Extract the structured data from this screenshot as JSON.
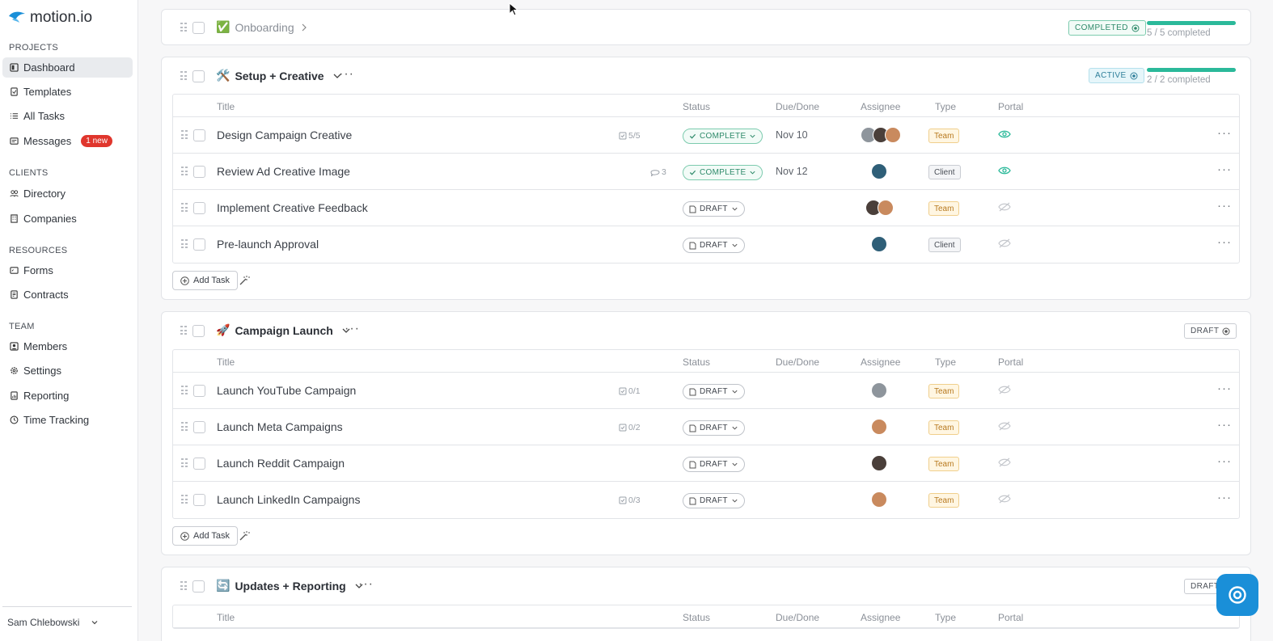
{
  "app": {
    "logo_text": "motion.io",
    "brand_color": "#1a8fd8"
  },
  "sidebar": {
    "sections": [
      {
        "label": "PROJECTS",
        "items": [
          {
            "label": "Dashboard",
            "icon": "dashboard-icon",
            "active": true
          },
          {
            "label": "Templates",
            "icon": "template-icon"
          },
          {
            "label": "All Tasks",
            "icon": "list-icon"
          },
          {
            "label": "Messages",
            "icon": "message-icon",
            "badge": "1 new"
          }
        ]
      },
      {
        "label": "CLIENTS",
        "items": [
          {
            "label": "Directory",
            "icon": "people-icon"
          },
          {
            "label": "Companies",
            "icon": "building-icon"
          }
        ]
      },
      {
        "label": "RESOURCES",
        "items": [
          {
            "label": "Forms",
            "icon": "form-icon"
          },
          {
            "label": "Contracts",
            "icon": "contract-icon"
          }
        ]
      },
      {
        "label": "TEAM",
        "items": [
          {
            "label": "Members",
            "icon": "members-icon"
          },
          {
            "label": "Settings",
            "icon": "gear-icon"
          },
          {
            "label": "Reporting",
            "icon": "report-icon"
          },
          {
            "label": "Time Tracking",
            "icon": "clock-icon"
          }
        ]
      }
    ],
    "user": {
      "name": "Sam Chlebowski"
    }
  },
  "columns": {
    "title": "Title",
    "status": "Status",
    "due": "Due/Done",
    "assignee": "Assignee",
    "type": "Type",
    "portal": "Portal"
  },
  "add_task_label": "Add Task",
  "projects": [
    {
      "emoji": "✅",
      "name": "Onboarding",
      "status": "COMPLETED",
      "progress_text": "5 / 5 completed",
      "progress": 1.0
    },
    {
      "emoji": "🛠️",
      "name": "Setup + Creative",
      "status": "ACTIVE",
      "progress_text": "2 / 2 completed",
      "progress": 1.0,
      "tasks": [
        {
          "title": "Design Campaign Creative",
          "meta": "5/5",
          "status": "COMPLETE",
          "due": "Nov 10",
          "type": "Team",
          "portal_visible": true
        },
        {
          "title": "Review Ad Creative Image",
          "meta": "3",
          "status": "COMPLETE",
          "due": "Nov 12",
          "type": "Client",
          "portal_visible": true
        },
        {
          "title": "Implement Creative Feedback",
          "meta": "",
          "status": "DRAFT",
          "due": "",
          "type": "Team",
          "portal_visible": false
        },
        {
          "title": "Pre-launch Approval",
          "meta": "",
          "status": "DRAFT",
          "due": "",
          "type": "Client",
          "portal_visible": false
        }
      ]
    },
    {
      "emoji": "🚀",
      "name": "Campaign Launch",
      "status": "DRAFT",
      "tasks": [
        {
          "title": "Launch YouTube Campaign",
          "meta": "0/1",
          "status": "DRAFT",
          "due": "",
          "type": "Team",
          "portal_visible": false
        },
        {
          "title": "Launch Meta Campaigns",
          "meta": "0/2",
          "status": "DRAFT",
          "due": "",
          "type": "Team",
          "portal_visible": false
        },
        {
          "title": "Launch Reddit Campaign",
          "meta": "",
          "status": "DRAFT",
          "due": "",
          "type": "Team",
          "portal_visible": false
        },
        {
          "title": "Launch LinkedIn Campaigns",
          "meta": "0/3",
          "status": "DRAFT",
          "due": "",
          "type": "Team",
          "portal_visible": false
        }
      ]
    },
    {
      "emoji": "🔄",
      "name": "Updates + Reporting",
      "status": "DRAFT"
    }
  ]
}
